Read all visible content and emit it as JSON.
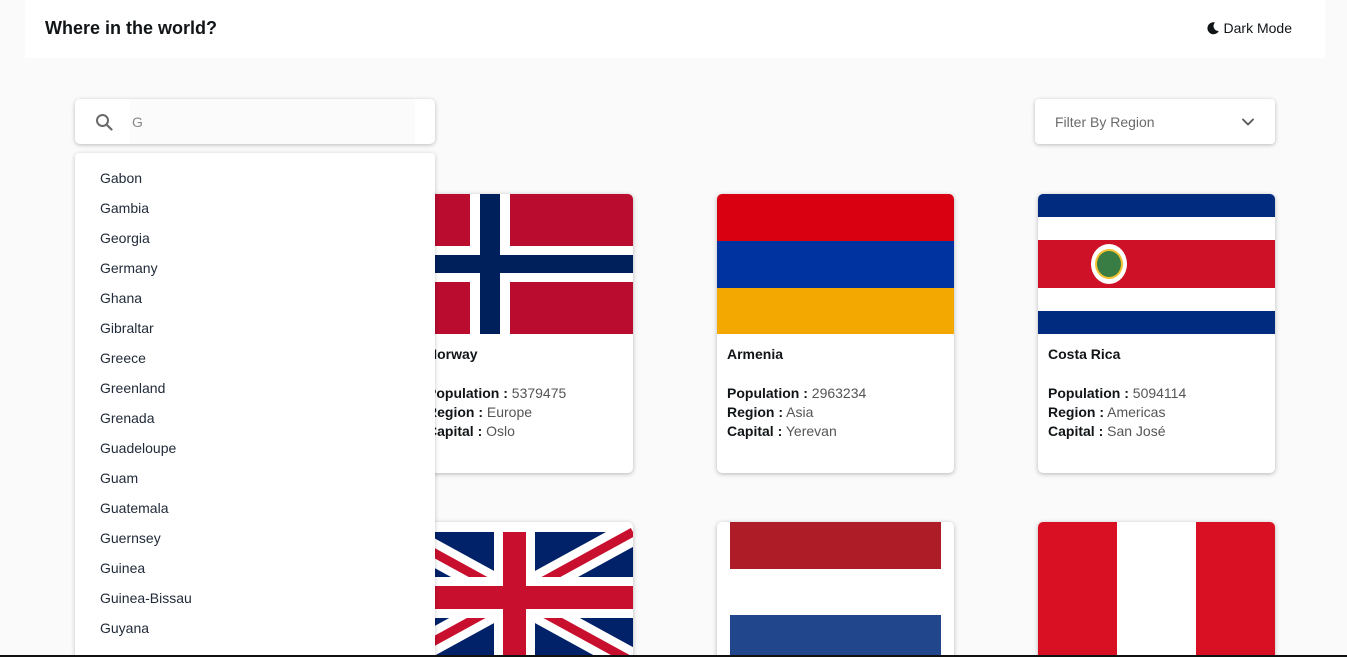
{
  "header": {
    "title": "Where in the world?",
    "dark_mode_label": "Dark Mode"
  },
  "search": {
    "value": "G",
    "icon": "search-icon"
  },
  "filter": {
    "label": "Filter By Region",
    "icon": "chevron-down-icon"
  },
  "suggestions": [
    "Gabon",
    "Gambia",
    "Georgia",
    "Germany",
    "Ghana",
    "Gibraltar",
    "Greece",
    "Greenland",
    "Grenada",
    "Guadeloupe",
    "Guam",
    "Guatemala",
    "Guernsey",
    "Guinea",
    "Guinea-Bissau",
    "Guyana"
  ],
  "field_labels": {
    "population": "Population :",
    "region": "Region :",
    "capital": "Capital :"
  },
  "cards": [
    {
      "name": "Norway",
      "population": "5379475",
      "region": "Europe",
      "capital": "Oslo"
    },
    {
      "name": "Armenia",
      "population": "2963234",
      "region": "Asia",
      "capital": "Yerevan"
    },
    {
      "name": "Costa Rica",
      "population": "5094114",
      "region": "Americas",
      "capital": "San José"
    }
  ],
  "colors": {
    "background": "#fafafa",
    "surface": "#ffffff",
    "text": "#111517"
  }
}
